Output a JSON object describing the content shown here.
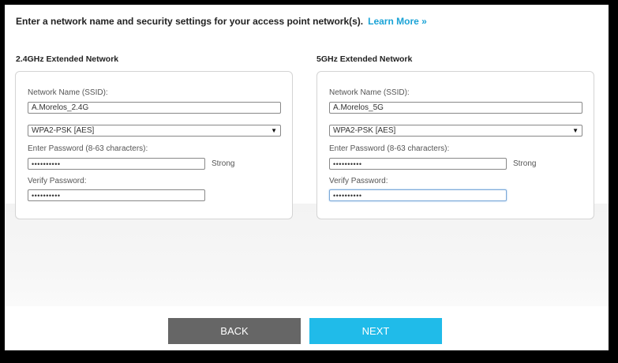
{
  "intro": {
    "text": "Enter a network name and security settings for your access point network(s).",
    "learn_more": "Learn More »"
  },
  "networks": [
    {
      "title": "2.4GHz Extended Network",
      "ssid_label": "Network Name (SSID):",
      "ssid_value": "A.Morelos_2.4G",
      "security_value": "WPA2-PSK [AES]",
      "password_label": "Enter Password (8-63 characters):",
      "password_value": "••••••••••",
      "strength": "Strong",
      "verify_label": "Verify Password:",
      "verify_value": "••••••••••"
    },
    {
      "title": "5GHz Extended Network",
      "ssid_label": "Network Name (SSID):",
      "ssid_value": "A.Morelos_5G",
      "security_value": "WPA2-PSK [AES]",
      "password_label": "Enter Password (8-63 characters):",
      "password_value": "••••••••••",
      "strength": "Strong",
      "verify_label": "Verify Password:",
      "verify_value": "••••••••••"
    }
  ],
  "buttons": {
    "back": "BACK",
    "next": "NEXT"
  },
  "icons": {
    "dropdown": "chevron-down-icon"
  },
  "colors": {
    "accent": "#20bbe9",
    "link": "#1aa3d6",
    "back_button": "#666666"
  }
}
